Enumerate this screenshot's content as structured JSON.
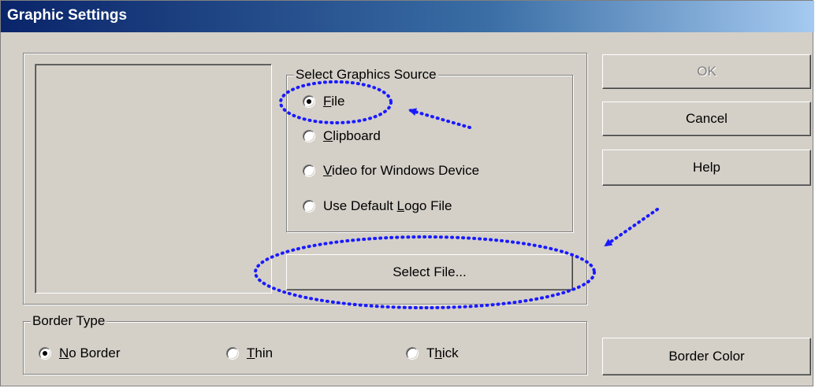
{
  "window": {
    "title": "Graphic Settings"
  },
  "source_group": {
    "legend": "Select Graphics Source",
    "options": [
      {
        "label_pre": "",
        "mnemonic": "F",
        "label_post": "ile",
        "selected": true
      },
      {
        "label_pre": "",
        "mnemonic": "C",
        "label_post": "lipboard",
        "selected": false
      },
      {
        "label_pre": "",
        "mnemonic": "V",
        "label_post": "ideo for Windows Device",
        "selected": false
      },
      {
        "label_pre": "Use Default ",
        "mnemonic": "L",
        "label_post": "ogo File",
        "selected": false
      }
    ]
  },
  "buttons": {
    "select_file": "Select File...",
    "ok": "OK",
    "cancel": "Cancel",
    "help": "Help",
    "border_color": "Border Color"
  },
  "border_group": {
    "legend": "Border Type",
    "options": [
      {
        "label_pre": "",
        "mnemonic": "N",
        "label_post": "o Border",
        "selected": true
      },
      {
        "label_pre": "",
        "mnemonic": "T",
        "label_post": "hin",
        "selected": false
      },
      {
        "label_pre": "T",
        "mnemonic": "h",
        "label_post": "ick",
        "selected": false
      }
    ]
  },
  "colors": {
    "annotation": "#1a1aff",
    "titlebar_start": "#0a246a",
    "dialog_face": "#d4d0c8"
  }
}
